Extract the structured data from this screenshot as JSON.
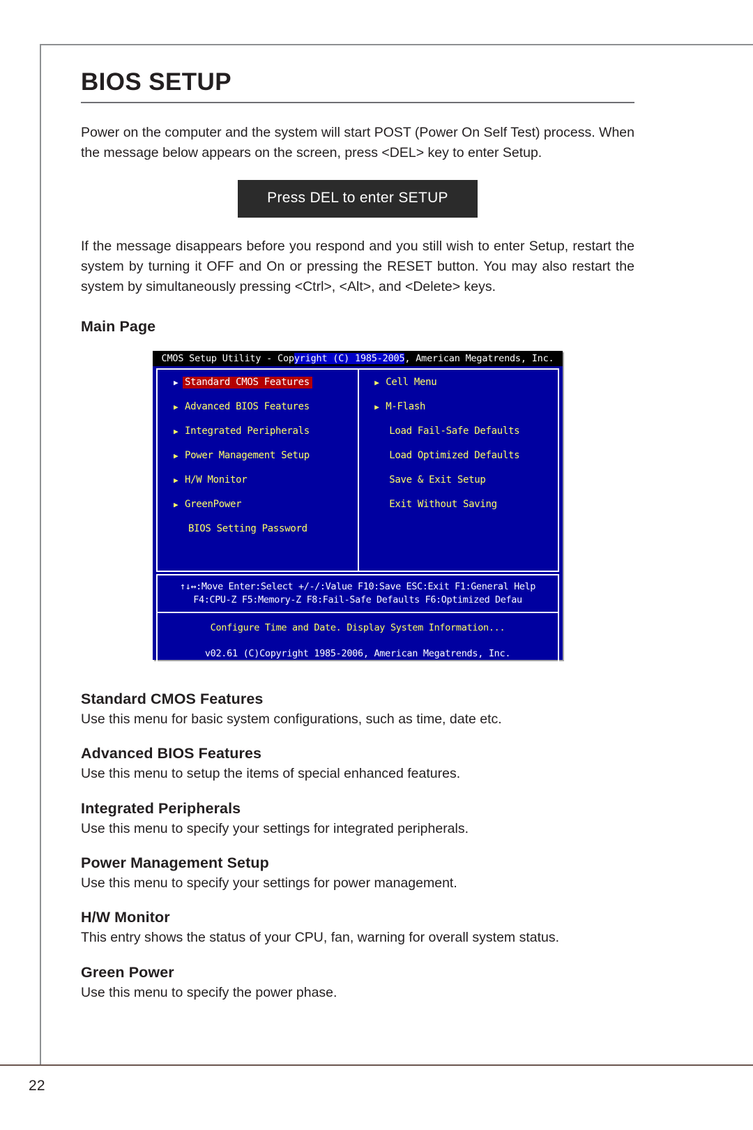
{
  "page": {
    "number": "22",
    "title": "BIOS SETUP"
  },
  "intro": {
    "paragraph": "Power on the computer and the system will start POST (Power On Self Test) process. When the message below appears on the screen, press <DEL> key to enter Setup."
  },
  "post_message": {
    "text": "Press DEL to enter SETUP"
  },
  "second": {
    "paragraph": "If the message disappears before you respond and you still wish to enter Setup, restart the system by turning it OFF and On or pressing the RESET button. You may also restart the system by simultaneously pressing <Ctrl>, <Alt>, and <Delete> keys."
  },
  "main_page": {
    "heading": "Main Page"
  },
  "bios": {
    "titlebar": {
      "prefix": "CMOS Setup Utility - Cop",
      "highlight": "yright (C) 1985-2005",
      "suffix": ", American Megatrends, Inc."
    },
    "left_column": [
      {
        "label": "Standard CMOS Features",
        "arrow": true,
        "selected": true
      },
      {
        "label": "Advanced BIOS Features",
        "arrow": true,
        "selected": false
      },
      {
        "label": "Integrated Peripherals",
        "arrow": true,
        "selected": false
      },
      {
        "label": "Power Management Setup",
        "arrow": true,
        "selected": false
      },
      {
        "label": "H/W Monitor",
        "arrow": true,
        "selected": false
      },
      {
        "label": "GreenPower",
        "arrow": true,
        "selected": false
      },
      {
        "label": "BIOS Setting Password",
        "arrow": false,
        "selected": false
      }
    ],
    "right_column": [
      {
        "label": "Cell Menu",
        "arrow": true,
        "selected": false
      },
      {
        "label": "M-Flash",
        "arrow": true,
        "selected": false
      },
      {
        "label": "Load Fail-Safe Defaults",
        "arrow": false,
        "selected": false
      },
      {
        "label": "Load Optimized Defaults",
        "arrow": false,
        "selected": false
      },
      {
        "label": "Save & Exit Setup",
        "arrow": false,
        "selected": false
      },
      {
        "label": "Exit Without Saving",
        "arrow": false,
        "selected": false
      }
    ],
    "help_line_1": "↑↓↔:Move  Enter:Select  +/-/:Value  F10:Save  ESC:Exit  F1:General Help",
    "help_line_2": "F4:CPU-Z    F5:Memory-Z    F8:Fail-Safe Defaults    F6:Optimized Defau",
    "status_line": "Configure Time and Date.  Display System Information...",
    "version_line": "v02.61 (C)Copyright 1985-2006, American Megatrends, Inc.",
    "colors": {
      "background": "#0000a0",
      "titlebar_background": "#000000",
      "item_text": "#ffff66",
      "selected_background": "#b40000",
      "selected_text": "#ffffff",
      "help_text": "#ffffff"
    }
  },
  "descriptions": [
    {
      "heading": "Standard CMOS Features",
      "text": "Use this menu for basic system configurations, such as time, date etc."
    },
    {
      "heading": "Advanced BIOS Features",
      "text": "Use this menu to setup the items of special enhanced features."
    },
    {
      "heading": "Integrated Peripherals",
      "text": "Use this menu to specify your settings for integrated peripherals."
    },
    {
      "heading": "Power Management Setup",
      "text": "Use this menu to specify your settings for power management."
    },
    {
      "heading": "H/W Monitor",
      "text": "This entry shows the status of your CPU, fan, warning for overall system status."
    },
    {
      "heading": "Green Power",
      "text": "Use this menu to specify the power phase."
    }
  ]
}
